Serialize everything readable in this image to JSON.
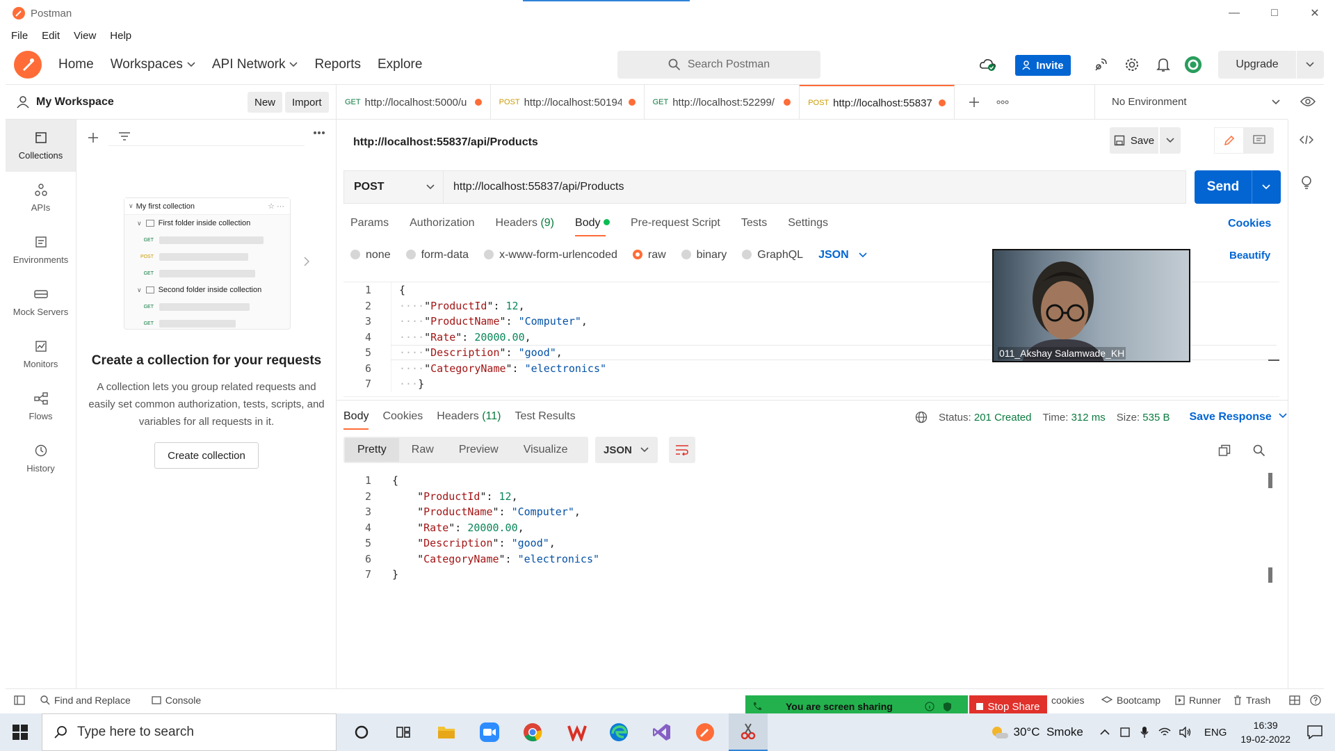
{
  "window": {
    "title": "Postman",
    "controls": [
      "minimize",
      "maximize",
      "close"
    ]
  },
  "menu": [
    "File",
    "Edit",
    "View",
    "Help"
  ],
  "header": {
    "nav": [
      {
        "label": "Home",
        "dropdown": false
      },
      {
        "label": "Workspaces",
        "dropdown": true
      },
      {
        "label": "API Network",
        "dropdown": true
      },
      {
        "label": "Reports",
        "dropdown": false
      },
      {
        "label": "Explore",
        "dropdown": false
      }
    ],
    "search_placeholder": "Search Postman",
    "invite": "Invite",
    "upgrade": "Upgrade"
  },
  "workspace": {
    "name": "My Workspace",
    "new": "New",
    "import": "Import"
  },
  "leftnav": [
    {
      "label": "Collections",
      "icon": "collections-icon",
      "active": true
    },
    {
      "label": "APIs",
      "icon": "apis-icon",
      "active": false
    },
    {
      "label": "Environments",
      "icon": "environments-icon",
      "active": false
    },
    {
      "label": "Mock Servers",
      "icon": "mock-servers-icon",
      "active": false
    },
    {
      "label": "Monitors",
      "icon": "monitors-icon",
      "active": false
    },
    {
      "label": "Flows",
      "icon": "flows-icon",
      "active": false
    },
    {
      "label": "History",
      "icon": "history-icon",
      "active": false
    }
  ],
  "illustration": {
    "collection": "My first collection",
    "folder1": "First folder inside collection",
    "folder2": "Second folder inside collection",
    "methods": [
      "GET",
      "POST",
      "GET",
      "GET",
      "GET"
    ]
  },
  "empty_state": {
    "title": "Create a collection for your requests",
    "description": "A collection lets you group related requests and easily set common authorization, tests, scripts, and variables for all requests in it.",
    "button": "Create collection"
  },
  "tabs": [
    {
      "method": "GET",
      "url": "http://localhost:5000/u",
      "active": false
    },
    {
      "method": "POST",
      "url": "http://localhost:50194",
      "active": false
    },
    {
      "method": "GET",
      "url": "http://localhost:52299/",
      "active": false
    },
    {
      "method": "POST",
      "url": "http://localhost:55837",
      "active": true
    }
  ],
  "environment": "No Environment",
  "request": {
    "title": "http://localhost:55837/api/Products",
    "save": "Save",
    "method": "POST",
    "url": "http://localhost:55837/api/Products",
    "send": "Send",
    "tabs": [
      "Params",
      "Authorization",
      "Headers",
      "Body",
      "Pre-request Script",
      "Tests",
      "Settings"
    ],
    "headers_count": "(9)",
    "cookies": "Cookies",
    "body_modes": [
      "none",
      "form-data",
      "x-www-form-urlencoded",
      "raw",
      "binary",
      "GraphQL"
    ],
    "selected_mode": "raw",
    "format": "JSON",
    "beautify": "Beautify"
  },
  "body_json": {
    "ProductId": 12,
    "ProductName": "Computer",
    "Rate": "20000.00",
    "Description": "good",
    "CategoryName": "electronics"
  },
  "response": {
    "tabs": [
      "Body",
      "Cookies",
      "Headers",
      "Test Results"
    ],
    "headers_count": "(11)",
    "status_label": "Status:",
    "status": "201 Created",
    "time_label": "Time:",
    "time": "312 ms",
    "size_label": "Size:",
    "size": "535 B",
    "save_response": "Save Response",
    "view_modes": [
      "Pretty",
      "Raw",
      "Preview",
      "Visualize"
    ],
    "format": "JSON"
  },
  "video": {
    "participant": "011_Akshay Salamwade_KH"
  },
  "statusbar": {
    "find_replace": "Find and Replace",
    "console": "Console",
    "cookies": "cookies",
    "bootcamp": "Bootcamp",
    "runner": "Runner",
    "trash": "Trash"
  },
  "screenshare": {
    "message": "You are screen sharing",
    "stop": "Stop Share"
  },
  "taskbar": {
    "search_placeholder": "Type here to search",
    "weather": "30°C  Smoke",
    "language": "ENG",
    "time": "16:39",
    "date": "19-02-2022"
  },
  "colors": {
    "accent": "#ff6c37",
    "primary": "#0265d2",
    "success": "#0a7a3e",
    "stop": "#e0312b",
    "share": "#23b14d"
  }
}
